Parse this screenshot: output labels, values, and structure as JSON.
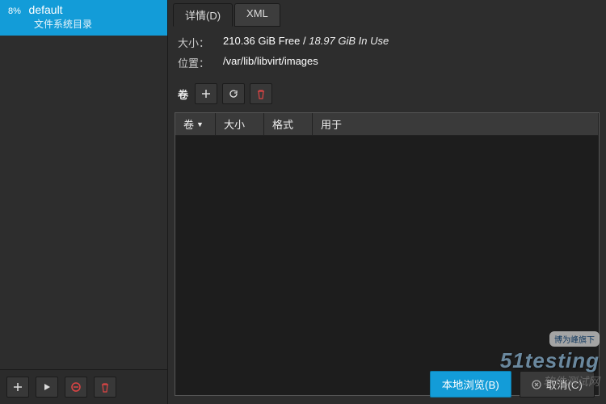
{
  "sidebar": {
    "pool": {
      "percent": "8%",
      "name": "default",
      "desc": "文件系统目录"
    }
  },
  "tabs": {
    "details": "详情(D)",
    "xml": "XML"
  },
  "info": {
    "size_label": "大小：",
    "size_free": "210.36 GiB Free",
    "size_sep": " / ",
    "size_used": "18.97 GiB In Use",
    "location_label": "位置：",
    "location_value": "/var/lib/libvirt/images"
  },
  "volumes": {
    "label": "卷",
    "headers": {
      "name": "卷",
      "size": "大小",
      "format": "格式",
      "used_by": "用于"
    }
  },
  "footer": {
    "browse": "本地浏览(B)",
    "cancel": "取消(C)"
  },
  "watermark": {
    "tag": "博为峰旗下",
    "main": "51testing",
    "sub": "软件测试网"
  }
}
